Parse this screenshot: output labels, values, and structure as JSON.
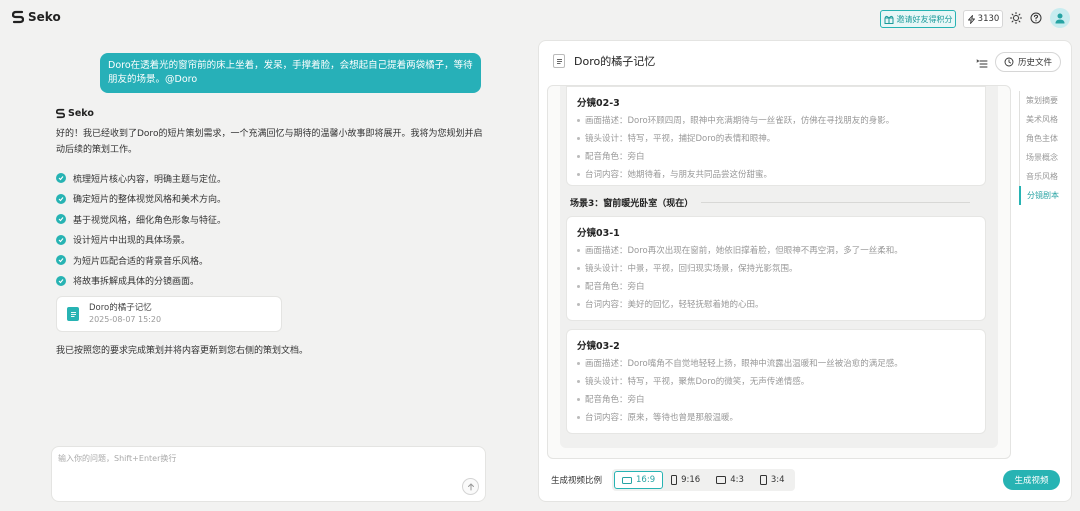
{
  "app": {
    "logo_text": "Seko"
  },
  "topbar": {
    "invite_label": "邀请好友得积分",
    "points": "3130"
  },
  "chat": {
    "user_message": "Doro在透着光的窗帘前的床上坐着，发呆，手撑着脸，会想起自己提着两袋橘子，等待朋友的场景。@Doro",
    "assistant_name": "Seko",
    "intro": "好的！我已经收到了Doro的短片策划需求，一个充满回忆与期待的温馨小故事即将展开。我将为您规划并启动后续的策划工作。",
    "steps": [
      "梳理短片核心内容，明确主题与定位。",
      "确定短片的整体视觉风格和美术方向。",
      "基于视觉风格，细化角色形象与特征。",
      "设计短片中出现的具体场景。",
      "为短片匹配合适的背景音乐风格。",
      "将故事拆解成具体的分镜画面。"
    ],
    "doc_card": {
      "title": "Doro的橘子记忆",
      "date": "2025-08-07 15:20"
    },
    "done_text": "我已按照您的要求完成策划并将内容更新到您右侧的策划文档。",
    "input_placeholder": "输入你的问题，Shift+Enter换行"
  },
  "panel": {
    "title": "Doro的橘子记忆",
    "history_label": "历史文件",
    "shots_before": [
      {
        "title": "分镜02-3",
        "lines": [
          "画面描述：Doro环顾四周，眼神中充满期待与一丝雀跃，仿佛在寻找朋友的身影。",
          "镜头设计：特写，平视，捕捉Doro的表情和眼神。",
          "配音角色：旁白",
          "台词内容：她期待着，与朋友共同品尝这份甜蜜。"
        ]
      }
    ],
    "scene_title": "场景3：窗前暖光卧室（现在）",
    "shots_after": [
      {
        "title": "分镜03-1",
        "lines": [
          "画面描述：Doro再次出现在窗前，她依旧撑着脸，但眼神不再空洞，多了一丝柔和。",
          "镜头设计：中景，平视，回归现实场景，保持光影氛围。",
          "配音角色：旁白",
          "台词内容：美好的回忆，轻轻抚慰着她的心田。"
        ]
      },
      {
        "title": "分镜03-2",
        "lines": [
          "画面描述：Doro嘴角不自觉地轻轻上扬，眼神中流露出温暖和一丝被治愈的满足感。",
          "镜头设计：特写，平视，聚焦Doro的微笑，无声传递情感。",
          "配音角色：旁白",
          "台词内容：原来，等待也曾是那般温暖。"
        ]
      }
    ],
    "outline": [
      "策划摘要",
      "美术风格",
      "角色主体",
      "场景概念",
      "音乐风格",
      "分镜剧本"
    ],
    "outline_active": 5,
    "ratio_label": "生成视频比例",
    "ratios": [
      "16:9",
      "9:16",
      "4:3",
      "3:4"
    ],
    "ratio_selected": "16:9",
    "generate_label": "生成视频"
  },
  "colors": {
    "accent": "#27b3b3",
    "user_bubble": "#27b0b8"
  }
}
